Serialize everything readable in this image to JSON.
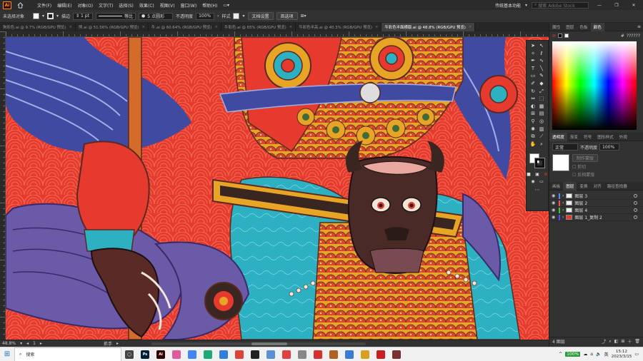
{
  "app": {
    "logo": "Ai",
    "workspace": "传统基本功能",
    "search_placeholder": "搜索 Adobe Stock"
  },
  "menu": [
    "文件(F)",
    "编辑(E)",
    "对象(O)",
    "文字(T)",
    "选择(S)",
    "效果(C)",
    "视图(V)",
    "窗口(W)",
    "帮助(H)"
  ],
  "control": {
    "selection": "未选择对象",
    "stroke_label": "描边",
    "stroke_weight": "1 pt",
    "profile": "等比",
    "brush": "5 点圆形",
    "opacity_label": "不透明度",
    "opacity": "100%",
    "style_label": "样式",
    "doc_settings": "文档设置",
    "preferences": "首选项"
  },
  "tabs": [
    {
      "label": "狗彩色.ai @ 9.7% (RGB/GPU 预览)",
      "active": false
    },
    {
      "label": "熊.ai @ 51.56% (RGB/GPU 预览)",
      "active": false
    },
    {
      "label": "牛.ai @ 60.64% (RGB/GPU 预览)",
      "active": false
    },
    {
      "label": "牛彩色.ai @ 65% (RGB/GPU 预览)",
      "active": false
    },
    {
      "label": "牛彩色半高.ai @ 40.3% (RGB/GPU 预览)",
      "active": false
    },
    {
      "label": "牛彩色半面横版.ai @ 48.8% (RGB/GPU 预览)",
      "active": true
    }
  ],
  "status": {
    "zoom": "48.8%",
    "artboard": "1",
    "mode": "抓手"
  },
  "panels": {
    "top_tabs": [
      "属性",
      "图层",
      "色板",
      "颜色"
    ],
    "hex": "??????",
    "transparency_tabs": [
      "透明度",
      "渐变",
      "符号",
      "图形样式",
      "外观"
    ],
    "blend_mode": "正常",
    "opacity_label": "不透明度",
    "opacity": "100%",
    "mask_btn": "制作蒙版",
    "clip_label": "剪切",
    "invert_label": "反相蒙版",
    "layer_tabs": [
      "画板",
      "图层",
      "变换",
      "对齐",
      "路径查找器"
    ],
    "layers": [
      {
        "name": "图层 3",
        "color": "#4d8cff"
      },
      {
        "name": "图层 2",
        "color": "#ff4d4d"
      },
      {
        "name": "图层 4",
        "color": "#3cc83c"
      },
      {
        "name": "图层 1_复制 2",
        "color": "#4d4dff"
      }
    ],
    "layer_count": "4 图层"
  },
  "taskbar": {
    "search": "搜索",
    "apps": [
      {
        "icon": "task-view-icon",
        "color": "#444444",
        "label": "◯"
      },
      {
        "icon": "photoshop-icon",
        "color": "#001e36",
        "label": "Ps"
      },
      {
        "icon": "illustrator-icon",
        "color": "#330000",
        "label": "Ai"
      },
      {
        "icon": "color-app-icon",
        "color": "#e05a9c",
        "label": ""
      },
      {
        "icon": "chrome-icon",
        "color": "#4285f4",
        "label": ""
      },
      {
        "icon": "edge-icon",
        "color": "#1fa97a",
        "label": ""
      },
      {
        "icon": "app-blue-icon",
        "color": "#2f7ee0",
        "label": ""
      },
      {
        "icon": "chrome2-icon",
        "color": "#db4437",
        "label": ""
      },
      {
        "icon": "qq-icon",
        "color": "#222222",
        "label": ""
      },
      {
        "icon": "app-cloud-icon",
        "color": "#5b8fd6",
        "label": ""
      },
      {
        "icon": "app-music-icon",
        "color": "#e04040",
        "label": ""
      },
      {
        "icon": "app-grey-icon",
        "color": "#888888",
        "label": ""
      },
      {
        "icon": "app-red-icon",
        "color": "#d83030",
        "label": ""
      },
      {
        "icon": "app-tool-icon",
        "color": "#b06020",
        "label": ""
      },
      {
        "icon": "app-blue2-icon",
        "color": "#3a7ad8",
        "label": ""
      },
      {
        "icon": "app-gold-icon",
        "color": "#d6a21e",
        "label": ""
      },
      {
        "icon": "app-red2-icon",
        "color": "#c82020",
        "label": ""
      },
      {
        "icon": "app-ai2-icon",
        "color": "#7a3030",
        "label": ""
      }
    ],
    "battery": "100%",
    "time": "15:12",
    "date": "2023/3/15"
  }
}
